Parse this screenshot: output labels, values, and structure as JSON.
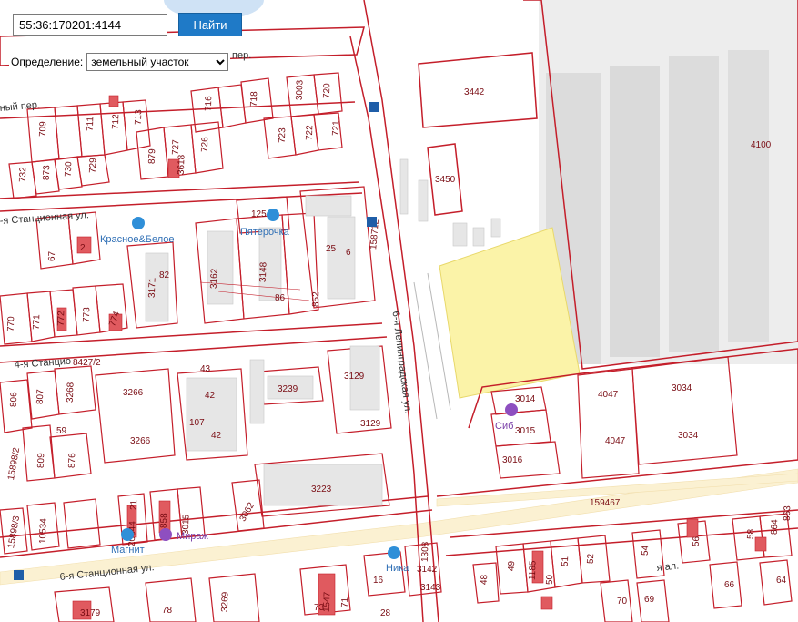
{
  "search": {
    "query": "55:36:170201:4144",
    "button_label": "Найти",
    "definition_label": "Определение:",
    "definition_value": "земельный участок"
  },
  "map": {
    "streets": {
      "leningradskaya": "6-я Ленинградская ул.",
      "stantsionnaya_top": "Станционная ул.",
      "stantsionnaya_4": "4-я Станцио",
      "stantsionnaya_6": "6-я Станционная ул.",
      "per_top": "пер.",
      "per_left": "ный пер.",
      "per_vert": "-я Станционная ул.",
      "al": "я ал."
    },
    "pois": {
      "krasnoe": "Красное&Белое",
      "pyaterochka": "Пятерочка",
      "magnit": "Магнит",
      "mirazh": "Мираж",
      "sib": "Сиб",
      "nika": "Ника"
    },
    "labels": {
      "l3442": "3442",
      "l4100": "4100",
      "l3450": "3450",
      "l720": "720",
      "l3003": "3003",
      "l718": "718",
      "l716": "716",
      "l713": "713",
      "l712": "712",
      "l711": "711",
      "l709": "709",
      "l721": "721",
      "l722": "722",
      "l723": "723",
      "l726": "726",
      "l727": "727",
      "l3618": "3618",
      "l879": "879",
      "l729": "729",
      "l730": "730",
      "l873": "873",
      "l732": "732",
      "l125": "125",
      "l158712": "158712",
      "l25": "25",
      "l6": "6",
      "l3162": "3162",
      "l3148": "3148",
      "l852": "852",
      "l86": "86",
      "l82": "82",
      "l3171": "3171",
      "l2": "2",
      "l67": "67",
      "l770": "770",
      "l771": "771",
      "l772": "772",
      "l773": "773",
      "l774": "774",
      "l8427": "8427/2",
      "l43": "43",
      "l42": "42",
      "l3239": "3239",
      "l3129": "3129",
      "l3266": "3266",
      "l107": "107",
      "l3268": "3268",
      "l807": "807",
      "l806": "806",
      "l59": "59",
      "l876": "876",
      "l809": "809",
      "l3014": "3014",
      "l3015": "3015",
      "l3016": "3016",
      "l4047": "4047",
      "l3034": "3034",
      "l159467": "159467",
      "l3223": "3223",
      "l3062": "3062",
      "l3015b": "3015",
      "l858": "858",
      "l20844": "20844",
      "l21": "21",
      "l10534": "10534",
      "l1308": "1308",
      "l3142": "3142",
      "l3143": "3143",
      "l16": "16",
      "l28": "28",
      "l3179": "3179",
      "l78": "78",
      "l3269": "3269",
      "l48": "48",
      "l49": "49",
      "l1185": "1185",
      "l50": "50",
      "l51": "51",
      "l52": "52",
      "l54": "54",
      "l56": "56",
      "l58": "58",
      "l864": "864",
      "l863": "863",
      "l64": "64",
      "l66": "66",
      "l69": "69",
      "l70": "70",
      "l71": "71",
      "l73": "73",
      "l81": "81",
      "l1582": "15898/3",
      "l1589": "15898/2",
      "l1547": "1547"
    }
  },
  "colors": {
    "parcel_border": "#c41e2a",
    "highlight_fill": "#fbf3a8",
    "button_bg": "#1f7ac7"
  }
}
